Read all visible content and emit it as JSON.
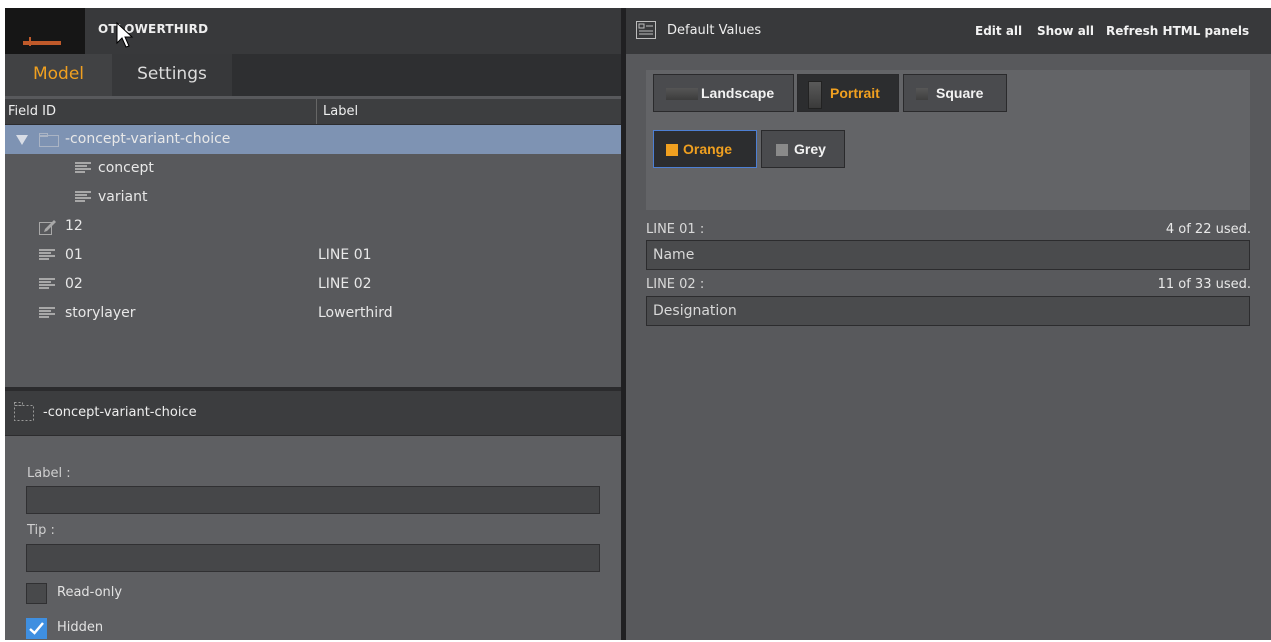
{
  "left": {
    "document_title": "OTLOWERTHIRD",
    "tabs": [
      {
        "label": "Model",
        "active": true
      },
      {
        "label": "Settings",
        "active": false
      }
    ],
    "columns": {
      "field_id": "Field ID",
      "label": "Label"
    },
    "tree": [
      {
        "name": "-concept-variant-choice",
        "label": "",
        "type": "folder",
        "expanded": true,
        "selected": true
      },
      {
        "name": "concept",
        "label": "",
        "type": "list"
      },
      {
        "name": "variant",
        "label": "",
        "type": "list"
      },
      {
        "name": "12",
        "label": "",
        "type": "edit"
      },
      {
        "name": "01",
        "label": "LINE 01",
        "type": "list"
      },
      {
        "name": "02",
        "label": "LINE 02",
        "type": "list"
      },
      {
        "name": "storylayer",
        "label": "Lowerthird",
        "type": "list"
      }
    ],
    "properties": {
      "header": "-concept-variant-choice",
      "label_caption": "Label :",
      "label_value": "",
      "tip_caption": "Tip :",
      "tip_value": "",
      "readonly_label": "Read-only",
      "readonly_checked": false,
      "hidden_label": "Hidden",
      "hidden_checked": true
    }
  },
  "right": {
    "title": "Default Values",
    "links": {
      "edit_all": "Edit all",
      "show_all": "Show all",
      "refresh": "Refresh HTML panels"
    },
    "orientation_options": [
      {
        "label": "Landscape",
        "selected": false
      },
      {
        "label": "Portrait",
        "selected": true
      },
      {
        "label": "Square",
        "selected": false
      }
    ],
    "color_options": [
      {
        "label": "Orange",
        "selected": true,
        "swatch": "#f0a020"
      },
      {
        "label": "Grey",
        "selected": false,
        "swatch": "#8a8a8a"
      }
    ],
    "fields": [
      {
        "caption": "LINE 01 :",
        "count": "4 of 22 used.",
        "value": "Name"
      },
      {
        "caption": "LINE 02 :",
        "count": "11 of 33 used.",
        "value": "Designation"
      }
    ]
  },
  "colors": {
    "accent": "#f0a020",
    "selection": "#7e93b3",
    "checkbox": "#3f8fe0"
  }
}
